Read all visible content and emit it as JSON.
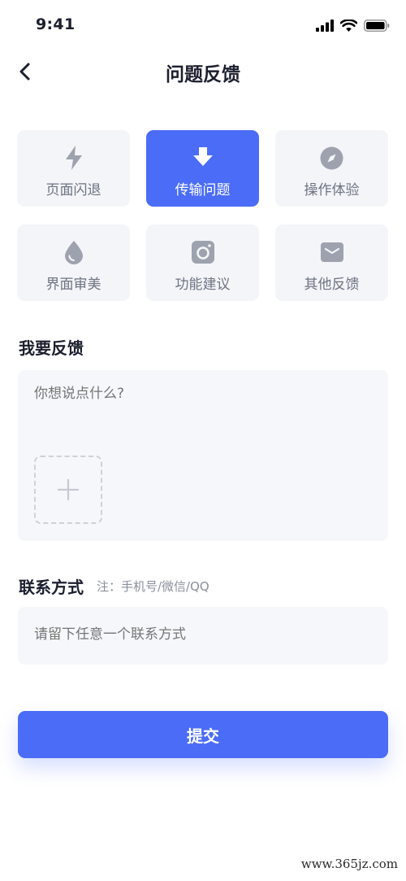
{
  "status_bar": {
    "time": "9:41"
  },
  "nav": {
    "title": "问题反馈",
    "back_icon": "chevron-left-icon"
  },
  "categories": [
    {
      "label": "页面闪退",
      "icon": "lightning-icon",
      "selected": false
    },
    {
      "label": "传输问题",
      "icon": "download-arrow-icon",
      "selected": true
    },
    {
      "label": "操作体验",
      "icon": "compass-icon",
      "selected": false
    },
    {
      "label": "界面审美",
      "icon": "droplet-icon",
      "selected": false
    },
    {
      "label": "功能建议",
      "icon": "camera-icon",
      "selected": false
    },
    {
      "label": "其他反馈",
      "icon": "envelope-icon",
      "selected": false
    }
  ],
  "feedback": {
    "title": "我要反馈",
    "placeholder": "你想说点什么?"
  },
  "contact": {
    "title": "联系方式",
    "note": "注：手机号/微信/QQ",
    "placeholder": "请留下任意一个联系方式"
  },
  "submit_label": "提交",
  "watermark": "www.365jz.com",
  "colors": {
    "accent": "#4a6cf7",
    "tile_bg": "#f4f5f8",
    "icon_gray": "#9da2ae"
  }
}
